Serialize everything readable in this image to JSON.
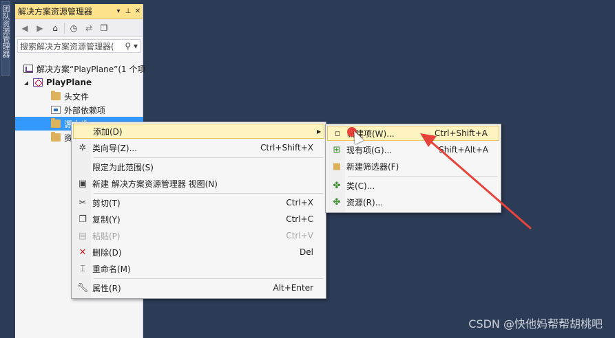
{
  "left_strip": {
    "tab_label": "团队资源管理器"
  },
  "panel": {
    "title": "解决方案资源管理器",
    "title_controls": {
      "dropdown": "▾",
      "pin": "⊥",
      "close": "✕"
    },
    "search_placeholder": "搜索解决方案资源管理器(",
    "tree": {
      "solution": "解决方案“PlayPlane”(1 个项",
      "project": "PlayPlane",
      "items": [
        "头文件",
        "外部依赖项",
        "源文件",
        "资"
      ]
    }
  },
  "context_menu": {
    "items": [
      {
        "label": "添加(D)",
        "shortcut": "",
        "icon": "none",
        "submenu": true
      },
      {
        "label": "类向导(Z)...",
        "shortcut": "Ctrl+Shift+X",
        "icon": "class-wizard-icon"
      },
      {
        "label": "限定为此范围(S)",
        "shortcut": "",
        "icon": "none"
      },
      {
        "label": "新建 解决方案资源管理器 视图(N)",
        "shortcut": "",
        "icon": "new-view-icon"
      },
      {
        "label": "剪切(T)",
        "shortcut": "Ctrl+X",
        "icon": "scissors-icon"
      },
      {
        "label": "复制(Y)",
        "shortcut": "Ctrl+C",
        "icon": "copy-icon"
      },
      {
        "label": "粘贴(P)",
        "shortcut": "Ctrl+V",
        "icon": "paste-icon",
        "disabled": true
      },
      {
        "label": "删除(D)",
        "shortcut": "Del",
        "icon": "delete-icon"
      },
      {
        "label": "重命名(M)",
        "shortcut": "",
        "icon": "rename-icon"
      },
      {
        "label": "属性(R)",
        "shortcut": "Alt+Enter",
        "icon": "wrench-icon"
      }
    ]
  },
  "submenu": {
    "items": [
      {
        "label": "新建项(W)...",
        "shortcut": "Ctrl+Shift+A",
        "icon": "new-item-icon"
      },
      {
        "label": "现有项(G)...",
        "shortcut": "Shift+Alt+A",
        "icon": "existing-item-icon"
      },
      {
        "label": "新建筛选器(F)",
        "shortcut": "",
        "icon": "new-filter-icon"
      },
      {
        "label": "类(C)...",
        "shortcut": "",
        "icon": "class-icon"
      },
      {
        "label": "资源(R)...",
        "shortcut": "",
        "icon": "resource-icon"
      }
    ]
  },
  "watermark": "CSDN @快他妈帮帮胡桃吧",
  "colors": {
    "background": "#2c3b56",
    "title_bar": "#ffe38c",
    "selection": "#3399ff",
    "highlight": "#fdf4bf",
    "annotation": "#e8433b"
  }
}
